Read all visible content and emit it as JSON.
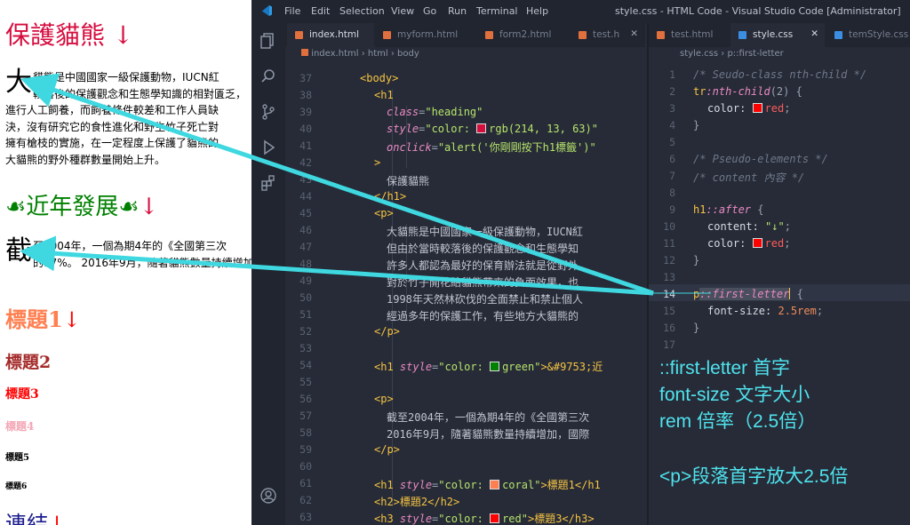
{
  "preview": {
    "h1": {
      "text": "保護貓熊",
      "arrow": "↓",
      "color": "#d60d3f"
    },
    "p1": {
      "first_letter": "大",
      "lines": [
        "貓熊是中國國家一級保護動物，IUCN紅",
        "較落後的保護觀念和生態學知識的相對匱乏，",
        "進行人工飼養，而飼養條件較差和工作人員缺",
        "決，沒有研究它的食性進化和野生竹子死亡對",
        "擁有槍枝的實施，在一定程度上保護了貓熊的",
        "大貓熊的野外種群數量開始上升。"
      ]
    },
    "h1_green": {
      "glyph": "☙",
      "text": "近年發展",
      "arrow": "↓",
      "color": "#008000"
    },
    "p2": {
      "first_letter": "截",
      "lines": [
        "至2004年，一個為期4年的《全國第三次",
        "的17%。 2016年9月，隨著貓熊數量持續增加"
      ]
    },
    "headings": [
      {
        "text": "標題1",
        "arrow": "↓",
        "color": "#ff7f50",
        "size": "h1"
      },
      {
        "text": "標題2",
        "color": "#a52a2a",
        "size": "h2"
      },
      {
        "text": "標題3",
        "color": "#ff0000",
        "size": "h3"
      },
      {
        "text": "標題4",
        "color": "#f4a6b6",
        "size": "h4"
      },
      {
        "text": "標題5",
        "color": "#000000",
        "size": "h5"
      },
      {
        "text": "標題6",
        "color": "#000000",
        "size": "h6"
      }
    ],
    "link_heading": {
      "text": "連結",
      "arrow": "↓"
    }
  },
  "vscode": {
    "menu": [
      "File",
      "Edit",
      "Selection",
      "View",
      "Go",
      "Run",
      "Terminal",
      "Help"
    ],
    "window_title": "style.css - HTML Code - Visual Studio Code [Administrator]",
    "left_tabs": [
      "index.html",
      "myform.html",
      "form2.html",
      "test.h"
    ],
    "right_tabs": [
      "test.html",
      "style.css",
      "temStyle.css"
    ],
    "active_right_tab": "style.css",
    "left_breadcrumb": {
      "file": "index.html",
      "parts": [
        "html",
        "body"
      ]
    },
    "right_breadcrumb": {
      "file": "style.css",
      "parts": [
        "p::first-letter"
      ]
    },
    "left_line_numbers": [
      "37",
      "38",
      "39",
      "40",
      "41",
      "42",
      "43",
      "44",
      "45",
      "46",
      "47",
      "48",
      "49",
      "50",
      "51",
      "52",
      "53",
      "54",
      "55",
      "56",
      "57",
      "58",
      "59",
      "60",
      "61",
      "62",
      "63"
    ],
    "right_line_numbers": [
      "1",
      "2",
      "3",
      "4",
      "5",
      "6",
      "7",
      "8",
      "9",
      "10",
      "11",
      "12",
      "13",
      "14",
      "15",
      "16",
      "17"
    ],
    "active_right_line": "14",
    "left_code": {
      "l37": "<body>",
      "l38": "<h1",
      "l39_attr": "class",
      "l39_val": "\"heading\"",
      "l40_attr": "style",
      "l40_val_a": "\"color: ",
      "l40_val_b": "rgb(214, 13, 63)\"",
      "l41_attr": "onclick",
      "l41_val": "\"alert('你剛剛按下h1標籤')\"",
      "l42": ">",
      "l43": "保護貓熊",
      "l44": "</h1>",
      "l45": "<p>",
      "l46": "大貓熊是中國國家一級保護動物，IUCN紅",
      "l47": "但由於當時較落後的保護觀念和生態學知",
      "l48": "許多人都認為最好的保育辦法就是從野外",
      "l49": "對於竹子開花給貓熊帶來的負面效果，也",
      "l50": "1998年天然林砍伐的全面禁止和禁止個人",
      "l51": "經過多年的保護工作，有些地方大貓熊的",
      "l52": "</p>",
      "l54_tag": "<h1",
      "l54_attr": "style",
      "l54_val": "\"color: ",
      "l54_col": "green\"",
      "l54_rest": ">&#9753;近",
      "l56": "<p>",
      "l57": "截至2004年，一個為期4年的《全國第三次",
      "l58": "2016年9月，隨著貓熊數量持續增加，國際",
      "l59": "</p>",
      "l61_tag": "<h1",
      "l61_attr": "style",
      "l61_val": "\"color: ",
      "l61_col": "coral\"",
      "l61_rest": ">標題1</h1",
      "l62": "<h2>標題2</h2>",
      "l63_tag": "<h3",
      "l63_attr": "style",
      "l63_val": "\"color: ",
      "l63_col": "red\"",
      "l63_rest": ">標題3</h3>"
    },
    "right_code": {
      "c1": "/* Seudo-class nth-child */",
      "c2_sel": "tr",
      "c2_pse": ":nth-child",
      "c2_arg": "(2)",
      "c2_br": " {",
      "c3_prop": "color: ",
      "c3_val": "red",
      "c4": "}",
      "c6": "/* Pseudo-elements */",
      "c7": "/* content 內容 */",
      "c9_sel": "h1",
      "c9_pse": "::after",
      "c9_br": " {",
      "c10_prop": "content: ",
      "c10_val": "\"↓\"",
      "c11_prop": "color: ",
      "c11_val": "red",
      "c12": "}",
      "c14_sel": "p",
      "c14_pse": "::first-letter",
      "c14_br": " {",
      "c15_prop": "font-size: ",
      "c15_val": "2.5rem",
      "c16": "}"
    },
    "swatch_colors": {
      "red": "#ff0000",
      "rgb": "#d60d3f",
      "green": "#008000",
      "coral": "#ff7f50"
    }
  },
  "annotations": {
    "line1": "::first-letter 首字",
    "line2": "font-size 文字大小",
    "line3": "rem 倍率（2.5倍）",
    "line4": "<p>段落首字放大2.5倍",
    "arrow_color": "#3fd8e0"
  }
}
